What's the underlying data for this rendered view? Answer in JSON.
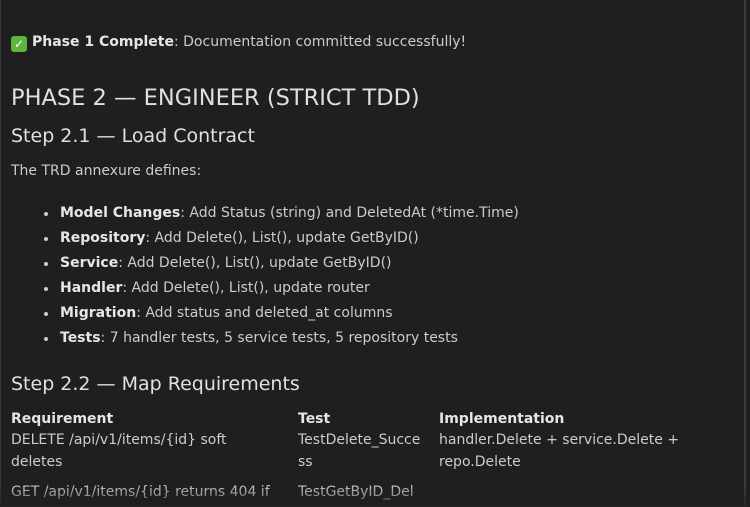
{
  "phase1": {
    "title": "Phase 1 Complete",
    "message": ": Documentation committed successfully!"
  },
  "phase2": {
    "heading": "PHASE 2 — ENGINEER (STRICT TDD)",
    "step1": {
      "heading": "Step 2.1 — Load Contract",
      "intro": "The TRD annexure defines:",
      "items": [
        {
          "label": "Model Changes",
          "text": ": Add Status (string) and DeletedAt (*time.Time)"
        },
        {
          "label": "Repository",
          "text": ": Add Delete(), List(), update GetByID()"
        },
        {
          "label": "Service",
          "text": ": Add Delete(), List(), update GetByID()"
        },
        {
          "label": "Handler",
          "text": ": Add Delete(), List(), update router"
        },
        {
          "label": "Migration",
          "text": ": Add status and deleted_at columns"
        },
        {
          "label": "Tests",
          "text": ": 7 handler tests, 5 service tests, 5 repository tests"
        }
      ]
    },
    "step2": {
      "heading": "Step 2.2 — Map Requirements",
      "table": {
        "headers": [
          "Requirement",
          "Test",
          "Implementation"
        ],
        "rows": [
          {
            "requirement": [
              "DELETE /api/v1/items/{id} soft",
              "deletes"
            ],
            "test": [
              "TestDelete_Succe",
              "ss"
            ],
            "implementation": [
              "handler.Delete + service.Delete +",
              "repo.Delete"
            ]
          },
          {
            "requirement": [
              "GET /api/v1/items/{id} returns 404 if"
            ],
            "test": [
              "TestGetByID_Del"
            ],
            "implementation": [
              ""
            ]
          }
        ]
      }
    }
  }
}
